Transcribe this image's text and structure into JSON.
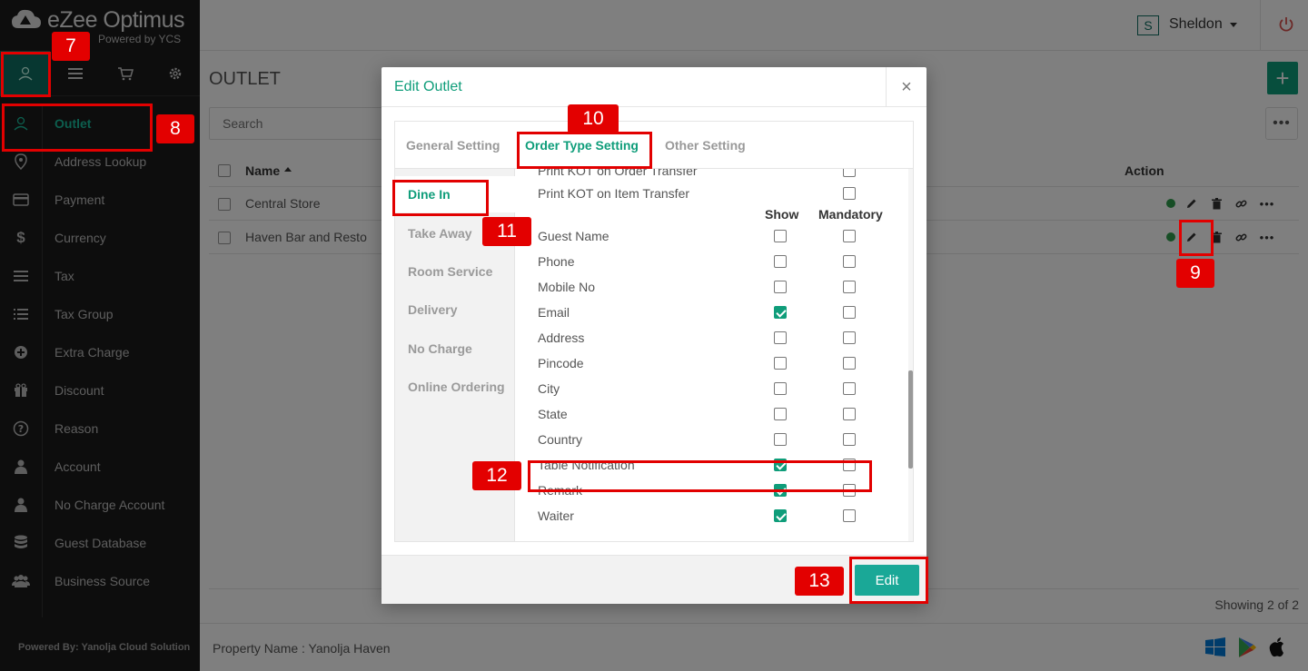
{
  "brand": {
    "title": "eZee Optimus",
    "subtitle": "Powered by YCS"
  },
  "sidebar": {
    "items": [
      {
        "label": "Outlet",
        "icon": "user-icon"
      },
      {
        "label": "Address Lookup",
        "icon": "map-pin-icon"
      },
      {
        "label": "Payment",
        "icon": "credit-card-icon"
      },
      {
        "label": "Currency",
        "icon": "dollar-icon"
      },
      {
        "label": "Tax",
        "icon": "lines-icon"
      },
      {
        "label": "Tax Group",
        "icon": "list-icon"
      },
      {
        "label": "Extra Charge",
        "icon": "plus-circle-icon"
      },
      {
        "label": "Discount",
        "icon": "gift-icon"
      },
      {
        "label": "Reason",
        "icon": "question-circle-icon"
      },
      {
        "label": "Account",
        "icon": "person-icon"
      },
      {
        "label": "No Charge Account",
        "icon": "person-icon"
      },
      {
        "label": "Guest Database",
        "icon": "database-icon"
      },
      {
        "label": "Business Source",
        "icon": "users-icon"
      }
    ],
    "powered_by": "Powered By: Yanolja Cloud Solution"
  },
  "topbar": {
    "avatar_letter": "S",
    "user_name": "Sheldon"
  },
  "main": {
    "title": "OUTLET",
    "add_label": "+",
    "search_placeholder": "Search",
    "more_label": "•••",
    "columns": {
      "name": "Name",
      "action": "Action"
    },
    "rows": [
      {
        "name": "Central Store"
      },
      {
        "name": "Haven Bar and Resto"
      }
    ],
    "showing": "Showing 2 of 2"
  },
  "footer": {
    "property": "Property Name : Yanolja Haven"
  },
  "modal": {
    "title": "Edit Outlet",
    "close": "×",
    "tabs": [
      "General Setting",
      "Order Type Setting",
      "Other Setting"
    ],
    "order_types": [
      "Dine In",
      "Take Away",
      "Room Service",
      "Delivery",
      "No Charge",
      "Online Ordering"
    ],
    "partial_field": "Print KOT on Order Transfer",
    "kot_field": "Print KOT on Item Transfer",
    "columns": {
      "show": "Show",
      "mandatory": "Mandatory"
    },
    "fields": [
      {
        "label": "Guest Name",
        "show": false,
        "mandatory": false
      },
      {
        "label": "Phone",
        "show": false,
        "mandatory": false
      },
      {
        "label": "Mobile No",
        "show": false,
        "mandatory": false
      },
      {
        "label": "Email",
        "show": true,
        "mandatory": false
      },
      {
        "label": "Address",
        "show": false,
        "mandatory": false
      },
      {
        "label": "Pincode",
        "show": false,
        "mandatory": false
      },
      {
        "label": "City",
        "show": false,
        "mandatory": false
      },
      {
        "label": "State",
        "show": false,
        "mandatory": false
      },
      {
        "label": "Country",
        "show": false,
        "mandatory": false
      },
      {
        "label": "Table Notification",
        "show": true,
        "mandatory": false
      },
      {
        "label": "Remark",
        "show": true,
        "mandatory": false
      },
      {
        "label": "Waiter",
        "show": true,
        "mandatory": false
      }
    ],
    "edit_button": "Edit"
  },
  "annotations": [
    "7",
    "8",
    "9",
    "10",
    "11",
    "12",
    "13"
  ],
  "colors": {
    "accent": "#0f9d7a",
    "annotation": "#e30000",
    "sidebar_bg": "#1a1a1a"
  }
}
